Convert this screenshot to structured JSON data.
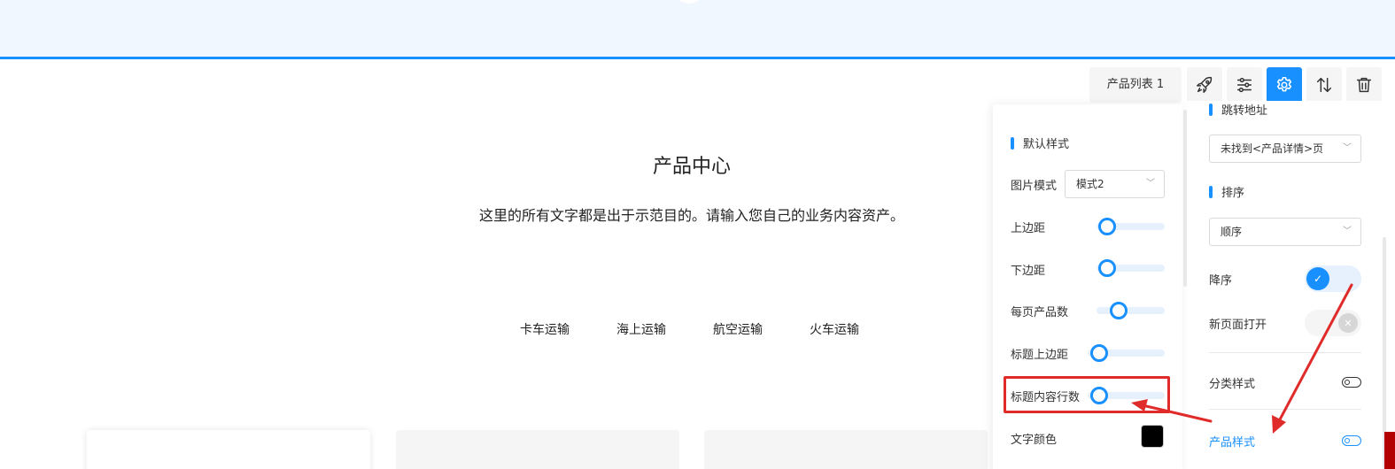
{
  "page": {
    "title": "产品中心",
    "subtitle": "这里的所有文字都是出于示范目的。请输入您自己的业务内容资产。",
    "categories": [
      "卡车运输",
      "海上运输",
      "航空运输",
      "火车运输"
    ]
  },
  "toolbar": {
    "component_name": "产品列表 1",
    "buttons": [
      "rocket-icon",
      "sliders-icon",
      "gear-icon",
      "sort-arrows-icon",
      "trash-icon"
    ],
    "active_color": "#1890ff"
  },
  "style_panel": {
    "section_title": "默认样式",
    "image_mode_label": "图片模式",
    "image_mode_value": "模式2",
    "margin_top_label": "上边距",
    "margin_top_value": 0.1,
    "margin_bottom_label": "下边距",
    "margin_bottom_value": 0.1,
    "per_page_label": "每页产品数",
    "per_page_value": 0.3,
    "title_margin_label": "标题上边距",
    "title_margin_value": 0.05,
    "title_lines_label": "标题内容行数",
    "title_lines_value": 0.05,
    "text_color_label": "文字颜色",
    "text_color": "#000000"
  },
  "settings_panel": {
    "link_label": "跳转地址",
    "link_value": "未找到<产品详情>页",
    "sort_title": "排序",
    "sort_value": "顺序",
    "desc_label": "降序",
    "desc_on": true,
    "new_page_label": "新页面打开",
    "new_page_on": false,
    "category_style_label": "分类样式",
    "product_style_label": "产品样式"
  },
  "colors": {
    "accent": "#1890ff",
    "annotation": "#e02b2b"
  }
}
